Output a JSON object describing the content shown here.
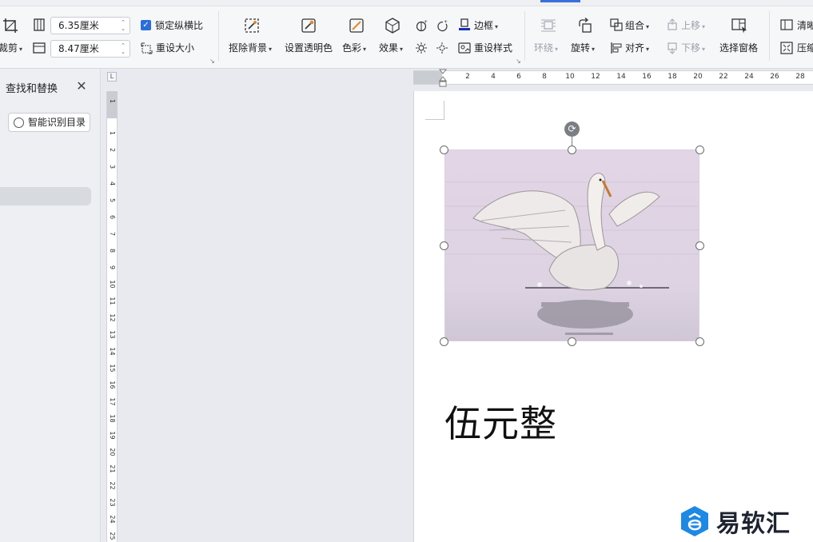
{
  "toolbar": {
    "crop_label": "裁剪",
    "width_value": "6.35厘米",
    "height_value": "8.47厘米",
    "lock_ratio_label": "锁定纵横比",
    "reset_size_label": "重设大小",
    "remove_bg_label": "抠除背景",
    "transparent_label": "设置透明色",
    "color_label": "色彩",
    "effect_label": "效果",
    "border_label": "边框",
    "reset_style_label": "重设样式",
    "wrap_label": "环绕",
    "rotate_label": "旋转",
    "group_label": "组合",
    "align_label": "对齐",
    "bring_up_label": "上移",
    "send_down_label": "下移",
    "select_pane_label": "选择窗格",
    "clear_label": "清晰",
    "compress_label": "压缩"
  },
  "sidebar": {
    "title": "查找和替换",
    "smart_toc_label": "智能识别目录"
  },
  "hruler": {
    "labels": [
      "2",
      "4",
      "6",
      "8",
      "10",
      "12",
      "14",
      "16",
      "18",
      "20",
      "22",
      "24",
      "26",
      "28"
    ]
  },
  "vruler": {
    "labels": [
      "1",
      "1",
      "2",
      "3",
      "4",
      "5",
      "6",
      "7",
      "8",
      "9",
      "10",
      "11",
      "12",
      "13",
      "14",
      "15",
      "16",
      "17",
      "18",
      "19",
      "20",
      "21",
      "22",
      "23",
      "24",
      "25"
    ]
  },
  "corner_label": "L",
  "document": {
    "text": "伍元整"
  },
  "watermark": {
    "text": "易软汇"
  },
  "colors": {
    "accent": "#2a6ddb",
    "watermark_blue": "#1e88e5"
  },
  "icons": [
    "crop-icon",
    "width-icon",
    "height-icon",
    "check-icon",
    "reset-size-icon",
    "remove-bg-icon",
    "transparent-icon",
    "color-icon",
    "effect-icon",
    "brightness-icon",
    "contrast-icon",
    "border-icon",
    "reset-style-icon",
    "wrap-icon",
    "rotate-icon",
    "group-icon",
    "align-icon",
    "bring-up-icon",
    "send-down-icon",
    "select-pane-icon",
    "clear-icon",
    "compress-icon",
    "close-icon",
    "smart-toc-icon",
    "rotate-handle-icon"
  ]
}
